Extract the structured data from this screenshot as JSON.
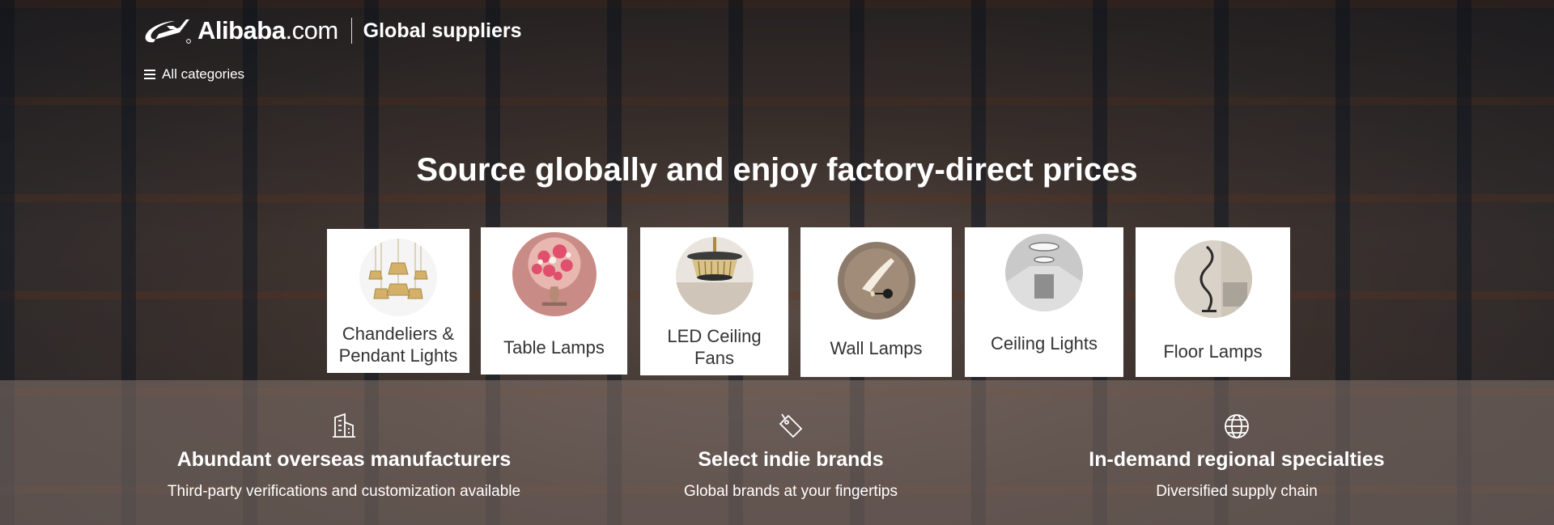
{
  "header": {
    "brand": "Alibaba",
    "brand_suffix": ".com",
    "subtitle": "Global suppliers",
    "all_categories": "All categories"
  },
  "hero": {
    "headline": "Source globally and enjoy factory-direct prices"
  },
  "categories": [
    {
      "label": "Chandeliers & Pendant Lights",
      "image": "chandeliers-image"
    },
    {
      "label": "Table Lamps",
      "image": "table-lamp-image"
    },
    {
      "label": "LED Ceiling Fans",
      "image": "ceiling-fan-image"
    },
    {
      "label": "Wall Lamps",
      "image": "wall-lamp-image"
    },
    {
      "label": "Ceiling Lights",
      "image": "ceiling-light-image"
    },
    {
      "label": "Floor Lamps",
      "image": "floor-lamp-image"
    }
  ],
  "features": [
    {
      "icon": "building-icon",
      "title": "Abundant overseas manufacturers",
      "desc": "Third-party verifications and customization available"
    },
    {
      "icon": "tag-icon",
      "title": "Select indie brands",
      "desc": "Global brands at your fingertips"
    },
    {
      "icon": "globe-icon",
      "title": "In-demand regional specialties",
      "desc": "Diversified supply chain"
    }
  ],
  "colors": {
    "text": "#ffffff",
    "card_background": "#ffffff",
    "card_text": "#333333"
  }
}
